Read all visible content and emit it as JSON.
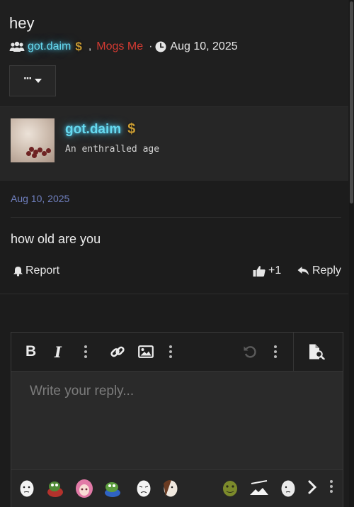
{
  "thread": {
    "title": "hey",
    "starter": "got.daim",
    "starter_badge": "$",
    "comma": ",",
    "mention": "Mogs Me",
    "sep": "·",
    "date": "Aug 10, 2025",
    "more_label": "···"
  },
  "post": {
    "author": "got.daim",
    "author_badge": "$",
    "author_title": "An enthralled age",
    "date": "Aug 10, 2025",
    "text": "how old are you",
    "report_label": "Report",
    "like_count": "+1",
    "reply_label": "Reply"
  },
  "editor": {
    "bold_label": "B",
    "italic_label": "I",
    "placeholder": "Write your reply..."
  },
  "emojis": [
    "wojak-face",
    "pepe-red",
    "anime-girl-pink",
    "pepe-blue",
    "wojak-crying",
    "wojak-brown",
    "shrek-face",
    "brush-art",
    "wojak-grey"
  ],
  "colors": {
    "glow_name": "#66d9ef",
    "mention": "#d23a32",
    "date_link": "#6f7fbe",
    "gold_badge": "#c79a32"
  }
}
